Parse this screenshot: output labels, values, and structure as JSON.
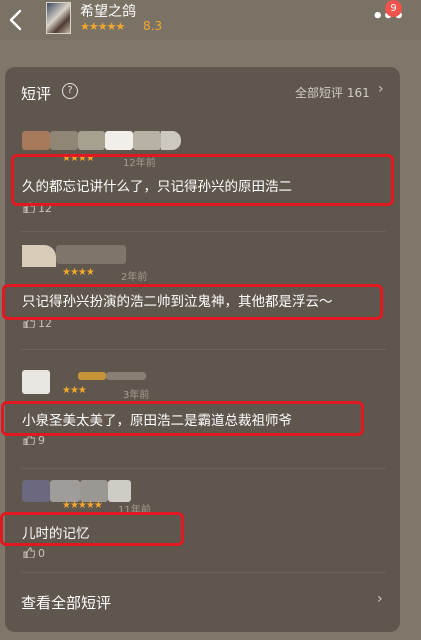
{
  "header": {
    "title": "希望之鸽",
    "stars": "★★★★★",
    "rating": "8.3",
    "more_icon": "•••",
    "notification_count": "9"
  },
  "section": {
    "title": "短评",
    "help_icon": "?",
    "all_label": "全部短评 161"
  },
  "reviews": [
    {
      "stars": "★★★★",
      "time": "12年前",
      "text": "久的都忘记讲什么了，只记得孙兴的原田浩二",
      "likes": "12"
    },
    {
      "stars": "★★★★",
      "time": "2年前",
      "text": "只记得孙兴扮演的浩二帅到泣鬼神，其他都是浮云～",
      "likes": "12"
    },
    {
      "stars": "★★★",
      "time": "3年前",
      "text": "小泉圣美太美了，原田浩二是霸道总裁祖师爷",
      "likes": "9"
    },
    {
      "stars": "★★★★★",
      "time": "11年前",
      "text": "儿时的记忆",
      "likes": "0"
    }
  ],
  "footer": {
    "view_all_label": "查看全部短评"
  }
}
